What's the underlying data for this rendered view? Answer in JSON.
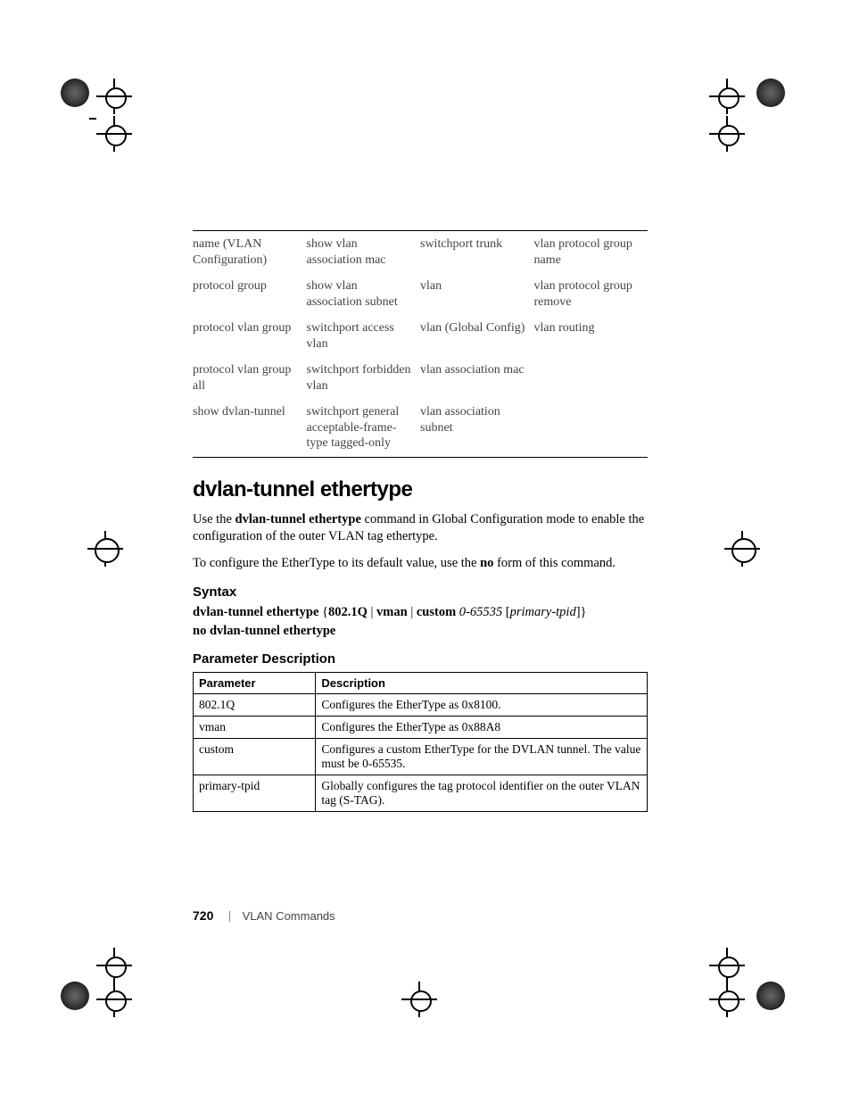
{
  "cmd_grid": {
    "rows": [
      [
        "name (VLAN Configuration)",
        "show vlan association mac",
        "switchport trunk",
        "vlan protocol group name"
      ],
      [
        "protocol group",
        "show vlan association subnet",
        "vlan",
        "vlan protocol group remove"
      ],
      [
        "protocol vlan group",
        "switchport access vlan",
        "vlan (Global Config)",
        "vlan routing"
      ],
      [
        "protocol vlan group all",
        "switchport forbidden vlan",
        "vlan association mac",
        ""
      ],
      [
        "show dvlan-tunnel",
        "switchport general acceptable-frame-type tagged-only",
        "vlan association subnet",
        ""
      ]
    ]
  },
  "section_title": "dvlan-tunnel ethertype",
  "intro_pre": "Use the ",
  "intro_bold": "dvlan-tunnel ethertype",
  "intro_post": " command in Global Configuration mode to enable the configuration of the outer VLAN tag ethertype.",
  "intro2_pre": "To configure the EtherType to its default value, use the ",
  "intro2_bold": "no",
  "intro2_post": " form of this command.",
  "syntax_heading": "Syntax",
  "syntax_line": {
    "cmd": "dvlan-tunnel ethertype",
    "opt1": "802.1Q",
    "opt2": "vman",
    "opt3": "custom",
    "range": "0-65535",
    "flag": "primary-tpid"
  },
  "syntax_no": "no dvlan-tunnel ethertype",
  "param_heading": "Parameter Description",
  "param_table": {
    "headers": [
      "Parameter",
      "Description"
    ],
    "rows": [
      [
        "802.1Q",
        "Configures the EtherType as 0x8100."
      ],
      [
        "vman",
        "Configures the EtherType as 0x88A8"
      ],
      [
        "custom",
        "Configures a custom EtherType for the DVLAN tunnel. The value must be 0-65535."
      ],
      [
        "primary-tpid",
        "Globally configures the tag protocol identifier on the outer VLAN tag (S-TAG)."
      ]
    ]
  },
  "footer": {
    "page": "720",
    "label": "VLAN Commands"
  }
}
